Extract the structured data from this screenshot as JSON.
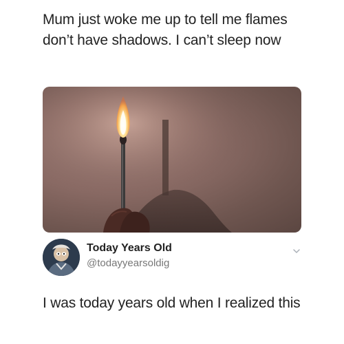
{
  "caption": {
    "text": "Mum just woke me up to tell me flames don’t have shadows. I can’t sleep now"
  },
  "image": {
    "icon": "match-flame-photo"
  },
  "profile": {
    "display_name": "Today Years Old",
    "handle": "@todayyearsoldig",
    "avatar_icon": "avatar-photo",
    "menu_icon": "chevron-down-icon"
  },
  "tweet": {
    "text": "I was today years old when I realized this"
  }
}
